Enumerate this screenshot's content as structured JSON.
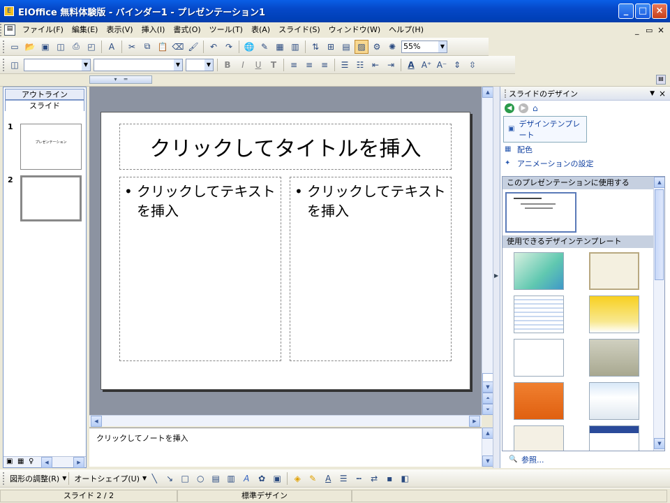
{
  "window": {
    "title": "EIOffice 無料体験版 - バインダー1 - プレゼンテーション1"
  },
  "menu": [
    "ファイル(F)",
    "編集(E)",
    "表示(V)",
    "挿入(I)",
    "書式(O)",
    "ツール(T)",
    "表(A)",
    "スライド(S)",
    "ウィンドウ(W)",
    "ヘルプ(H)"
  ],
  "toolbar": {
    "zoom": "55%"
  },
  "left_pane": {
    "tab_outline": "アウトライン",
    "tab_slide": "スライド",
    "thumb1_num": "1",
    "thumb1_text": "プレゼンテーション",
    "thumb2_num": "2"
  },
  "slide": {
    "title_placeholder": "クリックしてタイトルを挿入",
    "left_text": "クリックしてテキストを挿入",
    "right_text": "クリックしてテキストを挿入",
    "bullet": "•"
  },
  "notes": {
    "placeholder": "クリックしてノートを挿入"
  },
  "taskpane": {
    "title": "スライドのデザイン",
    "link_templates": "デザインテンプレート",
    "link_colors": "配色",
    "link_animation": "アニメーションの設定",
    "label": "デザインテンプレート:",
    "section_used": "このプレゼンテーションに使用する",
    "section_available": "使用できるデザインテンプレート",
    "browse": "参照..."
  },
  "drawbar": {
    "adjust": "図形の調整(R)",
    "autoshape": "オートシェイプ(U)"
  },
  "status": {
    "slide": "スライド 2 / 2",
    "design": "標準デザイン"
  },
  "colors": {
    "accent": "#0548c8",
    "workarea": "#8c93a1"
  }
}
